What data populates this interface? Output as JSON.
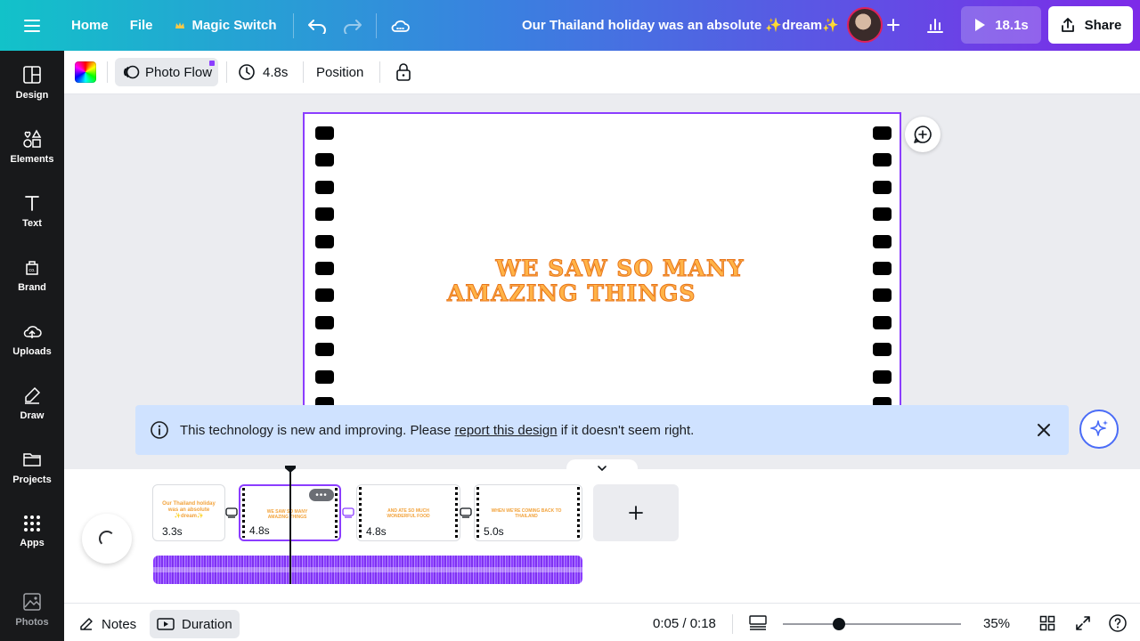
{
  "colors": {
    "accent": "#8b3dff",
    "banner": "#cfe2ff",
    "text_orange": "#ffb347"
  },
  "topbar": {
    "home": "Home",
    "file": "File",
    "magic_switch": "Magic Switch",
    "title": "Our Thailand holiday was an absolute ✨dream✨",
    "play_duration": "18.1s",
    "share": "Share"
  },
  "sidebar": {
    "items": [
      {
        "label": "Design",
        "icon": "design-icon"
      },
      {
        "label": "Elements",
        "icon": "elements-icon"
      },
      {
        "label": "Text",
        "icon": "text-icon"
      },
      {
        "label": "Brand",
        "icon": "brand-icon"
      },
      {
        "label": "Uploads",
        "icon": "uploads-icon"
      },
      {
        "label": "Draw",
        "icon": "draw-icon"
      },
      {
        "label": "Projects",
        "icon": "projects-icon"
      },
      {
        "label": "Apps",
        "icon": "apps-icon"
      },
      {
        "label": "Photos",
        "icon": "photos-icon"
      }
    ]
  },
  "context_toolbar": {
    "animation": "Photo Flow",
    "duration": "4.8s",
    "position": "Position"
  },
  "canvas": {
    "text_line1": "WE SAW SO MANY",
    "text_line2": "AMAZING THINGS"
  },
  "notice": {
    "prefix": "This technology is new and improving. Please ",
    "link": "report this design",
    "suffix": " if it doesn't seem right."
  },
  "timeline": {
    "scenes": [
      {
        "duration": "3.3s",
        "thumb": "Our Thailand holiday was an absolute ✨dream✨"
      },
      {
        "duration": "4.8s",
        "thumb": "WE SAW SO MANY AMAZING THINGS"
      },
      {
        "duration": "4.8s",
        "thumb": "AND ATE SO MUCH WONDERFUL FOOD"
      },
      {
        "duration": "5.0s",
        "thumb": "WHEN WE'RE COMING BACK TO THAILAND"
      }
    ]
  },
  "bottombar": {
    "notes": "Notes",
    "duration": "Duration",
    "time": "0:05 / 0:18",
    "zoom": "35%"
  }
}
